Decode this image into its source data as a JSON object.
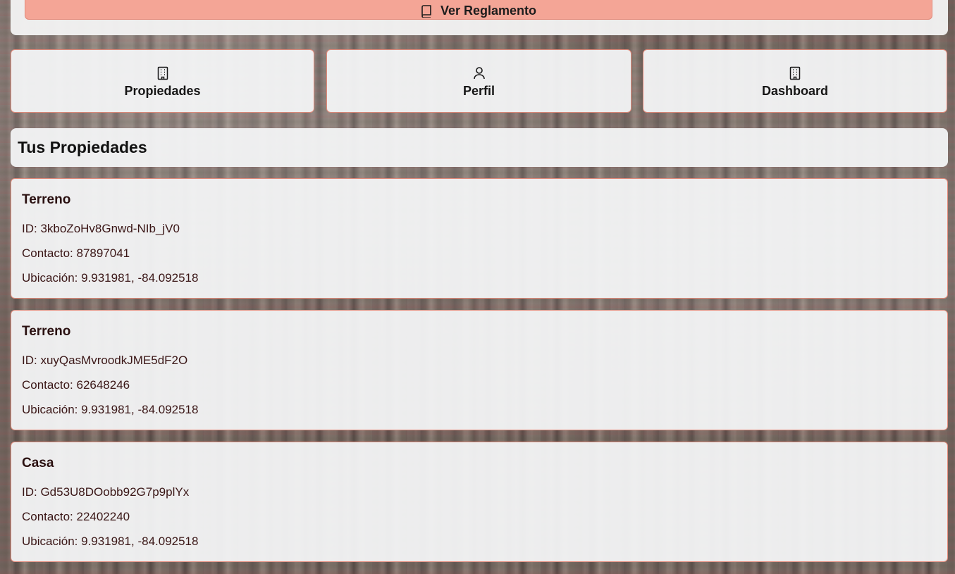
{
  "rules": {
    "label": "Ver Reglamento",
    "icon": "book-icon"
  },
  "nav": [
    {
      "label": "Propiedades",
      "icon": "building-icon"
    },
    {
      "label": "Perfil",
      "icon": "user-icon"
    },
    {
      "label": "Dashboard",
      "icon": "building-icon"
    }
  ],
  "section": {
    "title": "Tus Propiedades"
  },
  "properties": [
    {
      "name": "Terreno",
      "id": "ID: 3kboZoHv8Gnwd-NIb_jV0",
      "contact": "Contacto: 87897041",
      "location": "Ubicación: 9.931981, -84.092518"
    },
    {
      "name": "Terreno",
      "id": "ID: xuyQasMvroodkJME5dF2O",
      "contact": "Contacto: 62648246",
      "location": "Ubicación: 9.931981, -84.092518"
    },
    {
      "name": "Casa",
      "id": "ID: Gd53U8DOobb92G7p9plYx",
      "contact": "Contacto: 22402240",
      "location": "Ubicación: 9.931981, -84.092518"
    }
  ],
  "colors": {
    "accent": "#f4a596",
    "border": "#e28a7a",
    "card": "#f3f4f6"
  }
}
